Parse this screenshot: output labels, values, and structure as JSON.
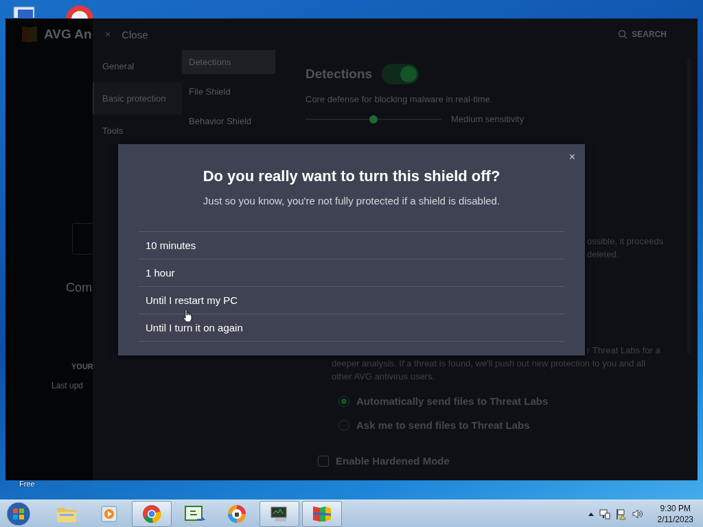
{
  "desktop": {
    "icon_label": "Free"
  },
  "app_window": {
    "title": "AVG An",
    "close_glyph": "×",
    "close_label": "Close",
    "search_label": "SEARCH",
    "left_panel": {
      "texts": [
        "Com",
        "YOUR",
        "Last upd"
      ]
    },
    "nav": [
      {
        "label": "General",
        "selected": false
      },
      {
        "label": "Basic protection",
        "selected": true
      },
      {
        "label": "Tools",
        "selected": false
      }
    ],
    "subnav": [
      {
        "label": "Detections",
        "selected": true
      },
      {
        "label": "File Shield",
        "selected": false
      },
      {
        "label": "Behavior Shield",
        "selected": false
      }
    ],
    "detail": {
      "title": "Detections",
      "toggle_on": true,
      "description": "Core defense for blocking malware in real-time.",
      "slider": {
        "level": 0.5,
        "label": "Medium sensitivity"
      },
      "fragments": [
        "ossible, it proceeds",
        "deleted."
      ],
      "continuation": "r Threat Labs for a",
      "paragraph_lines": [
        "deeper analysis. If a threat is found, we'll push out new protection to you and all",
        "other AVG antivirus users."
      ],
      "radios": [
        {
          "label": "Automatically send files to Threat Labs",
          "selected": true
        },
        {
          "label": "Ask me to send files to Threat Labs",
          "selected": false
        }
      ],
      "checkbox": {
        "label": "Enable Hardened Mode",
        "checked": false
      }
    }
  },
  "dialog": {
    "close_glyph": "×",
    "title": "Do you really want to turn this shield off?",
    "subtitle": "Just so you know, you're not fully protected if a shield is disabled.",
    "options": [
      "10 minutes",
      "1 hour",
      "Until I restart my PC",
      "Until I turn it on again"
    ]
  },
  "taskbar": {
    "apps": [
      {
        "kind": "folder",
        "active": false
      },
      {
        "kind": "media",
        "active": false
      },
      {
        "kind": "chrome",
        "active": true
      },
      {
        "kind": "code",
        "active": false
      },
      {
        "kind": "browser",
        "active": false
      },
      {
        "kind": "monitor",
        "active": true
      },
      {
        "kind": "avg",
        "active": true
      }
    ],
    "time": "9:30 PM",
    "date": "2/11/2023"
  }
}
